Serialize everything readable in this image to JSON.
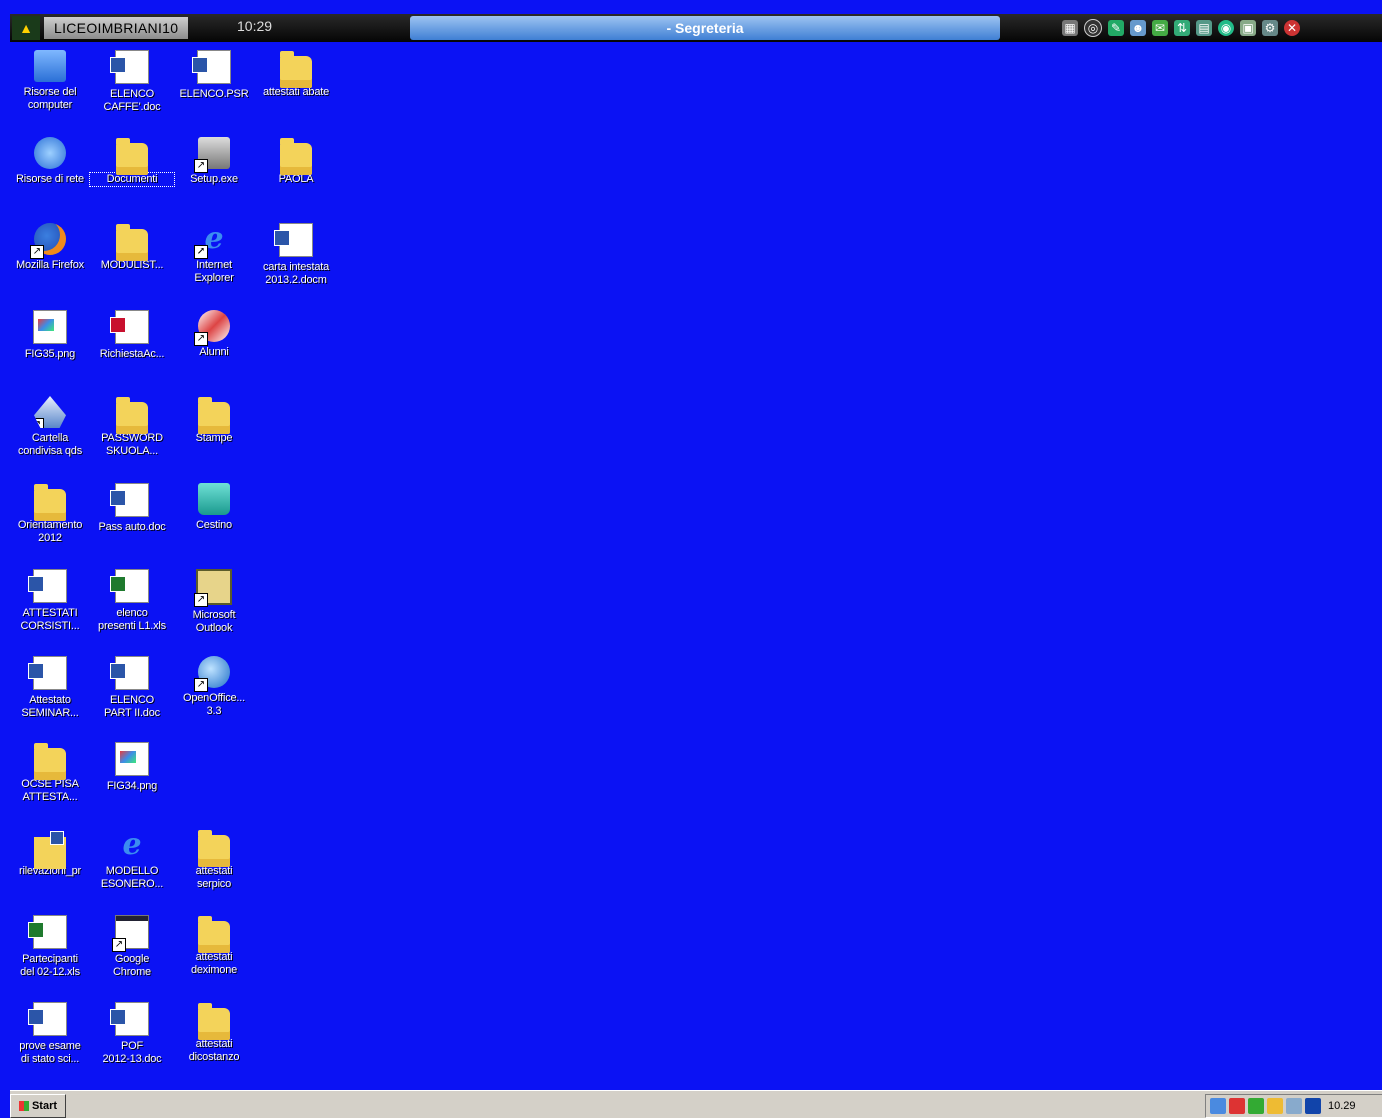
{
  "session_bar": {
    "host": "LICEOIMBRIANI10",
    "time": "10:29",
    "title": "- Segreteria"
  },
  "desktop_icons": [
    {
      "label": "Risorse del\ncomputer",
      "icon": "computer-icon"
    },
    {
      "label": "ELENCO\nCAFFE'.doc",
      "icon": "word-doc-icon"
    },
    {
      "label": "ELENCO.PSR",
      "icon": "psr-file-icon"
    },
    {
      "label": "attestati abate",
      "icon": "folder-icon"
    },
    {
      "label": "Risorse di rete",
      "icon": "network-icon"
    },
    {
      "label": "Documenti",
      "icon": "documents-folder-icon"
    },
    {
      "label": "Setup.exe",
      "icon": "setup-icon"
    },
    {
      "label": "PAOLA",
      "icon": "folder-icon"
    },
    {
      "label": "Mozilla Firefox",
      "icon": "firefox-icon"
    },
    {
      "label": "MODULIST...",
      "icon": "folder-icon"
    },
    {
      "label": "Internet\nExplorer",
      "icon": "ie-icon"
    },
    {
      "label": "carta intestata\n2013.2.docm",
      "icon": "word-doc-icon"
    },
    {
      "label": "FIG35.png",
      "icon": "image-icon"
    },
    {
      "label": "RichiestaAc...",
      "icon": "pdf-icon"
    },
    {
      "label": "Alunni",
      "icon": "alunni-icon"
    },
    {
      "label": "Cartella\ncondivisa qds",
      "icon": "shared-folder-icon"
    },
    {
      "label": "PASSWORD\nSKUOLA...",
      "icon": "folder-icon"
    },
    {
      "label": "Stampe",
      "icon": "folder-icon"
    },
    {
      "label": "Orientamento\n2012",
      "icon": "folder-icon"
    },
    {
      "label": "Pass auto.doc",
      "icon": "word-doc-icon"
    },
    {
      "label": "Cestino",
      "icon": "recycle-bin-icon"
    },
    {
      "label": "ATTESTATI\nCORSISTI...",
      "icon": "word-doc-icon"
    },
    {
      "label": "elenco\npresenti L1.xls",
      "icon": "excel-icon"
    },
    {
      "label": "Microsoft\nOutlook",
      "icon": "outlook-icon"
    },
    {
      "label": "Attestato\nSEMINAR...",
      "icon": "word-doc-icon"
    },
    {
      "label": "ELENCO\nPART II.doc",
      "icon": "word-doc-icon"
    },
    {
      "label": "OpenOffice...\n3.3",
      "icon": "openoffice-icon"
    },
    {
      "label": "OCSE PISA\nATTESTA...",
      "icon": "folder-icon"
    },
    {
      "label": "FIG34.png",
      "icon": "image-icon"
    },
    {
      "label": "rilevazioni_pr",
      "icon": "zip-folder-icon"
    },
    {
      "label": "MODELLO\nESONERO...",
      "icon": "ie-icon"
    },
    {
      "label": "attestati\nserpico",
      "icon": "folder-icon"
    },
    {
      "label": "Partecipanti\ndel 02-12.xls",
      "icon": "excel-icon"
    },
    {
      "label": "Google\nChrome",
      "icon": "chrome-icon"
    },
    {
      "label": "attestati\ndeximone",
      "icon": "folder-icon"
    },
    {
      "label": "prove esame\ndi stato sci...",
      "icon": "word-doc-icon"
    },
    {
      "label": "POF\n2012-13.doc",
      "icon": "word-doc-icon"
    },
    {
      "label": "attestati\ndicostanzo",
      "icon": "folder-icon"
    }
  ],
  "taskbar": {
    "start_label": "Start",
    "clock": "10.29"
  },
  "colors": {
    "desktop_bg": "#0b12f4",
    "taskbar_bg": "#d4d0c8",
    "title_bar": "#6aa2e6"
  }
}
